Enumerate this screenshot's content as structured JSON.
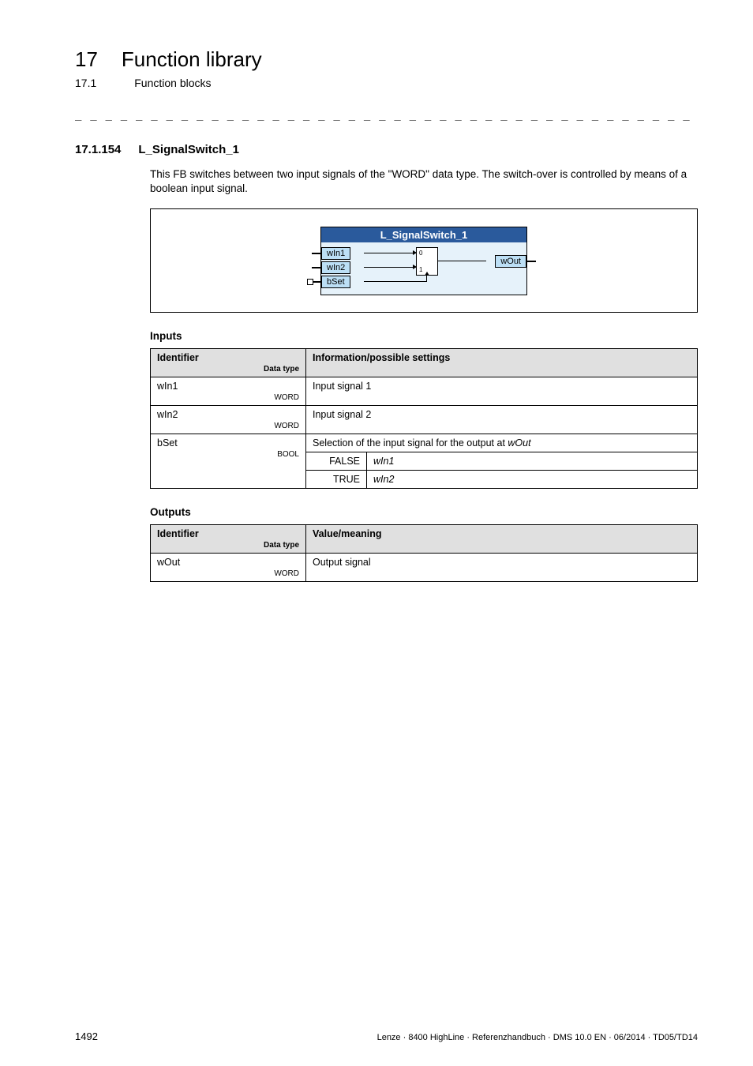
{
  "header": {
    "chapter_num": "17",
    "chapter_title": "Function library",
    "sub_num": "17.1",
    "sub_title": "Function blocks"
  },
  "section": {
    "num": "17.1.154",
    "title": "L_SignalSwitch_1",
    "description": "This FB switches between two input signals of the \"WORD\" data type. The switch-over is controlled by means of a boolean input signal."
  },
  "diagram": {
    "block_title": "L_SignalSwitch_1",
    "in1": "wIn1",
    "in2": "wIn2",
    "bset": "bSet",
    "out": "wOut",
    "mux0": "0",
    "mux1": "1"
  },
  "inputs_heading": "Inputs",
  "inputs_table": {
    "col1": "Identifier",
    "col1_sub": "Data type",
    "col2": "Information/possible settings",
    "rows": [
      {
        "id": "wIn1",
        "dtype": "WORD",
        "info": "Input signal 1"
      },
      {
        "id": "wIn2",
        "dtype": "WORD",
        "info": "Input signal 2"
      }
    ],
    "bset_row": {
      "id": "bSet",
      "dtype": "BOOL",
      "info": "Selection of the input signal for the output at",
      "info_italic": "wOut",
      "sub": [
        {
          "k": "FALSE",
          "v": "wIn1"
        },
        {
          "k": "TRUE",
          "v": "wIn2"
        }
      ]
    }
  },
  "outputs_heading": "Outputs",
  "outputs_table": {
    "col1": "Identifier",
    "col1_sub": "Data type",
    "col2": "Value/meaning",
    "rows": [
      {
        "id": "wOut",
        "dtype": "WORD",
        "info": "Output signal"
      }
    ]
  },
  "footer": {
    "page": "1492",
    "doc": "Lenze · 8400 HighLine · Referenzhandbuch · DMS 10.0 EN · 06/2014 · TD05/TD14"
  }
}
